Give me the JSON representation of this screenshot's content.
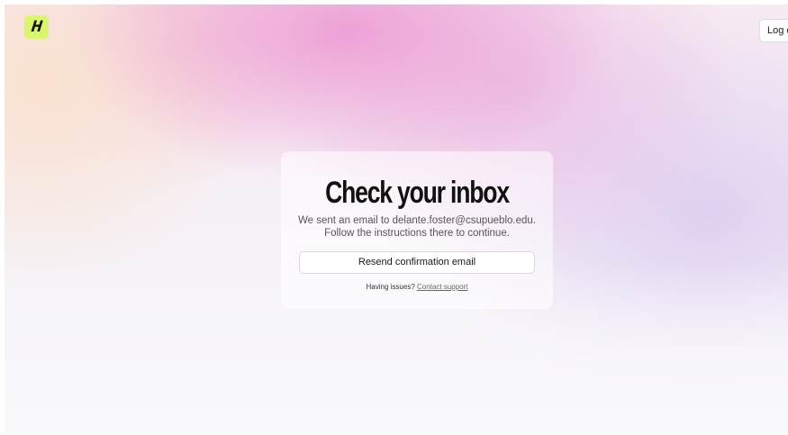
{
  "header": {
    "logo_text": "H",
    "logo_color": "#d8f76a",
    "logout_label": "Log ou"
  },
  "card": {
    "title": "Check your inbox",
    "message_line1": "We sent an email to delante.foster@csupueblo.edu.",
    "message_line2": "Follow the instructions there to continue.",
    "resend_label": "Resend confirmation email",
    "help_text": "Having issues?",
    "help_link": "Contact support"
  }
}
